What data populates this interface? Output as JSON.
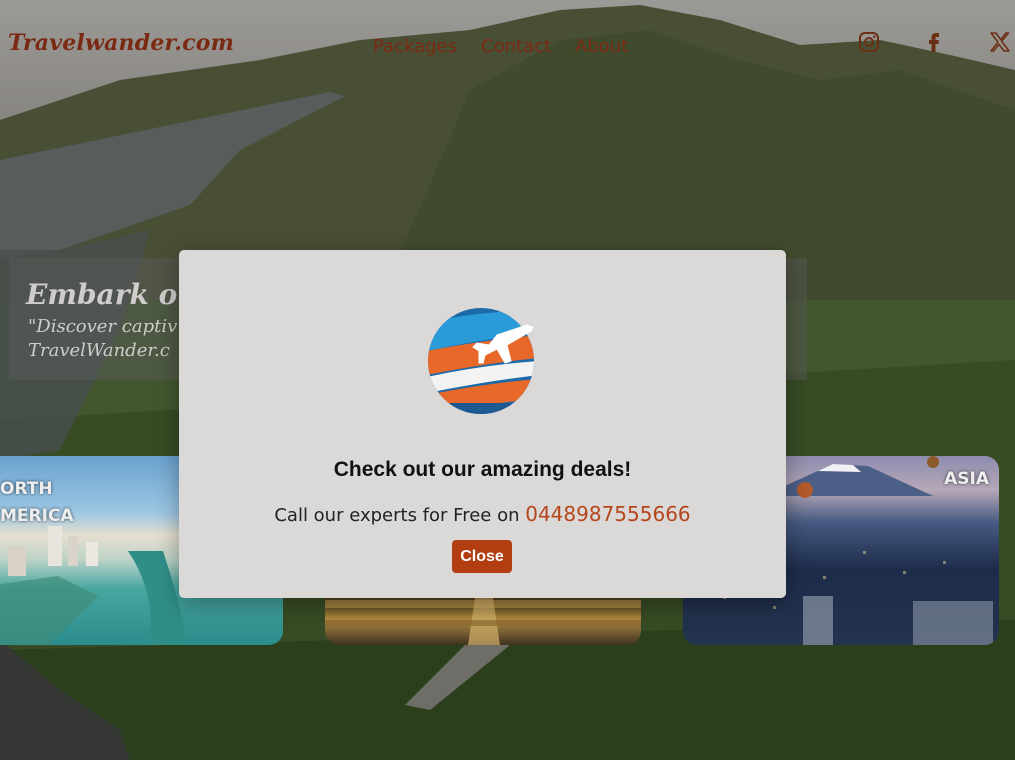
{
  "brand": "Travelwander.com",
  "nav": {
    "links": [
      "Packages",
      "Contact",
      "About"
    ]
  },
  "socials": [
    "instagram-icon",
    "facebook-icon",
    "x-icon"
  ],
  "hero": {
    "title": "Embark on",
    "subtitle_line1": "\"Discover captiv",
    "subtitle_line2": "TravelWander.c"
  },
  "cards": [
    {
      "label_line1": "ORTH",
      "label_line2": "MERICA"
    },
    {
      "label": ""
    },
    {
      "label": "ASIA"
    }
  ],
  "modal": {
    "heading": "Check out our amazing deals!",
    "call_text": "Call our experts for Free on ",
    "phone": "0448987555666",
    "close_label": "Close"
  },
  "colors": {
    "brand": "#7a2a12",
    "accent": "#b23d10",
    "modal_bg": "#dbd8d8"
  }
}
